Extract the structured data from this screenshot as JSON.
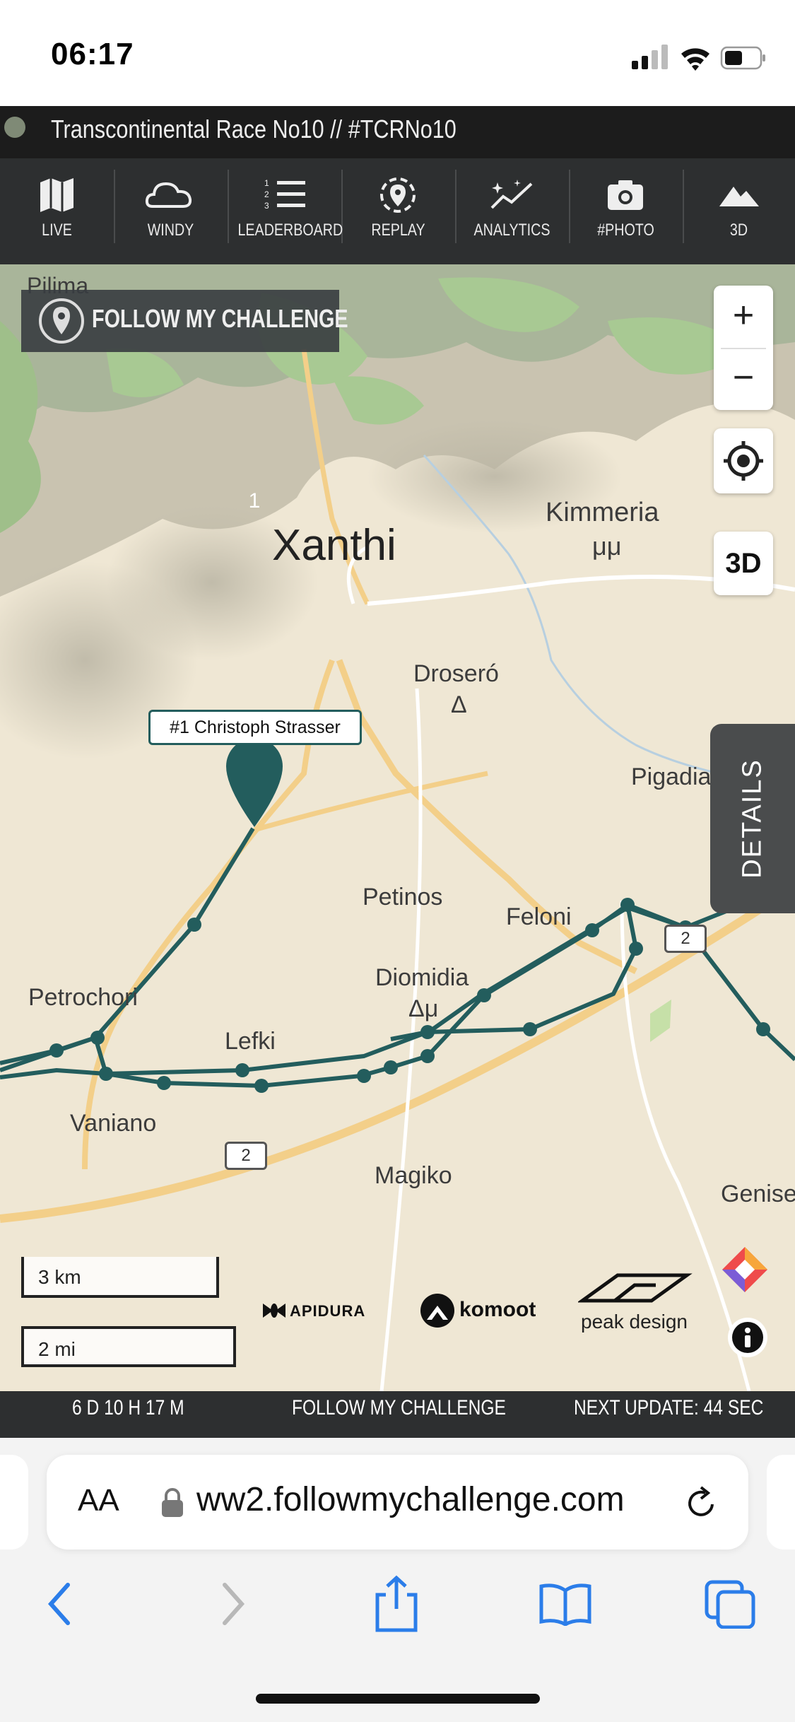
{
  "status_bar": {
    "time": "06:17"
  },
  "title_bar": {
    "title": "Transcontinental Race No10 // #TCRNo10"
  },
  "nav": {
    "items": [
      {
        "label": "LIVE",
        "icon": "map-icon"
      },
      {
        "label": "WINDY",
        "icon": "cloud-icon"
      },
      {
        "label": "LEADERBOARD",
        "icon": "list-icon"
      },
      {
        "label": "REPLAY",
        "icon": "replay-icon"
      },
      {
        "label": "ANALYTICS",
        "icon": "analytics-icon"
      },
      {
        "label": "#PHOTO",
        "icon": "camera-icon"
      },
      {
        "label": "3D",
        "icon": "mountain-icon"
      }
    ]
  },
  "map": {
    "badge": "FOLLOW MY CHALLENGE",
    "zoom_in": "+",
    "zoom_out": "−",
    "btn_3d": "3D",
    "details": "DETAILS",
    "rider_label": "#1 Christoph Strasser",
    "rider_pin": "1",
    "places": {
      "pilima": "Pilima",
      "xanthi": "Xanthi",
      "kimmeria": "Kimmeria",
      "kimmeria_sym": "μμ",
      "drosero": "Droseró",
      "drosero_sym": "Δ",
      "pigadia": "Pigadia",
      "petinos": "Petinos",
      "feloni": "Feloni",
      "diomidia": "Diomidia",
      "diomidia_sym": "Δμ",
      "petrochori": "Petrochori",
      "lefki": "Lefki",
      "vaniano": "Vaniano",
      "magiko": "Magiko",
      "genise": "Genise"
    },
    "road_shields": [
      "2",
      "2"
    ],
    "scale_km": "3 km",
    "scale_mi": "2 mi",
    "sponsors": {
      "apidura": "APIDURA",
      "komoot": "komoot",
      "peak": "peak design"
    },
    "route_color": "#235d5d"
  },
  "info_bar": {
    "elapsed": "6 D 10 H 17 M",
    "brand": "FOLLOW MY CHALLENGE",
    "next_update": "NEXT UPDATE: 44 SEC"
  },
  "browser": {
    "aa": "AA",
    "url": "ww2.followmychallenge.com"
  }
}
